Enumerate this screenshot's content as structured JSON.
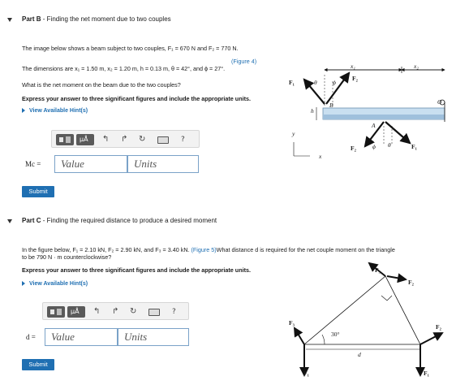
{
  "part_b": {
    "title_prefix": "Part B",
    "title_text": " - Finding the net moment due to two couples",
    "intro": "The image below shows a beam subject to two couples, F₁ = 670 N and F₂ = 770 N.",
    "figure_link": "(Figure 4)",
    "dimensions": "The dimensions are x₁ = 1.50 m, x₂ = 1.20 m, h = 0.13 m, θ = 42°, and ϕ = 27°.",
    "question": "What is the net moment on the beam due to the two couples?",
    "instruction": "Express your answer to three significant figures and include the appropriate units.",
    "hints": "View Available Hint(s)",
    "answer_label": "Mc =",
    "value_placeholder": "Value",
    "units_placeholder": "Units",
    "submit": "Submit",
    "toolbar_help": "?",
    "figure_labels": {
      "x1": "x₁",
      "x2": "x₂",
      "F1": "F₁",
      "F2": "F₂",
      "theta": "θ",
      "phi": "ϕ",
      "h": "h",
      "B": "B",
      "A": "A",
      "O": "O",
      "y": "y",
      "x": "x"
    }
  },
  "part_c": {
    "title_prefix": "Part C",
    "title_text": " - Finding the required distance to produce a desired moment",
    "line1": "In the figure below, F₁ = 2.10 kN, F₂ = 2.90 kN, and F₃ = 3.40 kN.",
    "figure_link": "(Figure 5)",
    "line1_tail": "What distance d is required for the net couple moment on the triangle",
    "line2": "to be 790 N · m counterclockwise?",
    "instruction": "Express your answer to three significant figures and include the appropriate units.",
    "hints": "View Available Hint(s)",
    "answer_label": "d =",
    "value_placeholder": "Value",
    "units_placeholder": "Units",
    "submit": "Submit",
    "toolbar_help": "?",
    "figure_labels": {
      "F1": "F₁",
      "F1b": "F₁",
      "F2": "F₂",
      "F2b": "F₂",
      "F3": "F₃",
      "F3b": "F₃",
      "angle": "30°",
      "d": "d"
    }
  },
  "colors": {
    "link": "#1f6fb2",
    "beam": "#c9dff0",
    "field_border": "#7aa2c8"
  }
}
